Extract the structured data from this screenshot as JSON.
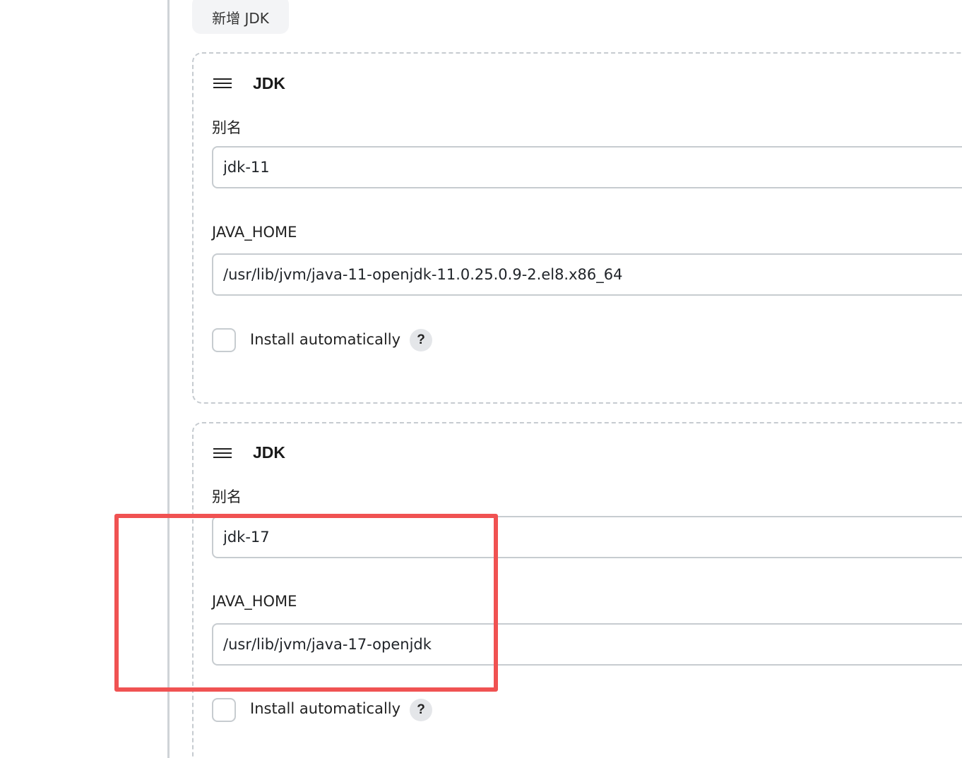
{
  "add_button": {
    "label": "新增 JDK"
  },
  "installations": [
    {
      "title": "JDK",
      "alias_label": "别名",
      "alias_value": "jdk-11",
      "java_home_label": "JAVA_HOME",
      "java_home_value": "/usr/lib/jvm/java-11-openjdk-11.0.25.0.9-2.el8.x86_64",
      "install_auto_label": "Install automatically",
      "install_auto_checked": false,
      "help_icon": "?"
    },
    {
      "title": "JDK",
      "alias_label": "别名",
      "alias_value": "jdk-17",
      "java_home_label": "JAVA_HOME",
      "java_home_value": "/usr/lib/jvm/java-17-openjdk",
      "install_auto_label": "Install automatically",
      "install_auto_checked": false,
      "help_icon": "?"
    }
  ],
  "annotation": {
    "highlight_color": "#f05252"
  },
  "icons": {
    "drag_handle": "drag-handle-icon",
    "help": "help-icon"
  }
}
